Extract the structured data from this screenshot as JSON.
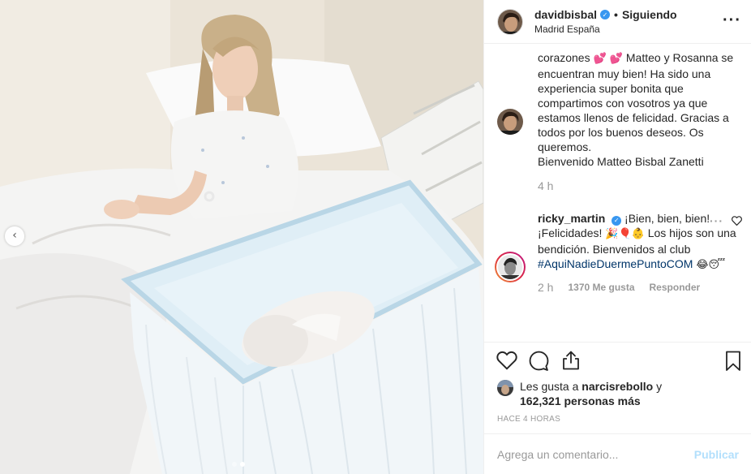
{
  "post": {
    "username": "davidbisbal",
    "verified": true,
    "separator": "•",
    "follow_status": "Siguiendo",
    "location": "Madrid España",
    "more_icon": "more-horizontal-icon"
  },
  "media": {
    "prev_icon": "chevron-left-icon",
    "prev_glyph": "‹",
    "slide_count": 2,
    "active_slide": 2
  },
  "caption": {
    "line_a": "corazones ",
    "emoji_a": "💕 💕",
    "line_b": " Matteo y Rosanna se encuentran muy bien! Ha sido una experiencia super bonita que compartimos con vosotros ya que estamos llenos de felicidad. Gracias a todos por los buenos deseos. Os queremos.",
    "line_c": "Bienvenido Matteo Bisbal Zanetti",
    "time": "4 h"
  },
  "comment": {
    "username": "ricky_martin",
    "verified": true,
    "text_a": " ¡Bien, bien, bien!¡Felicidades! ",
    "emoji_a": "🎉🎈👶",
    "text_b": " Los hijos son una bendición. Bienvenidos al club ",
    "hashtag": "#AquiNadieDuermePuntoCOM",
    "emoji_b": "😂😴",
    "time": "2 h",
    "likes": "1370 Me gusta",
    "reply": "Responder"
  },
  "likes": {
    "prefix": "Les gusta a ",
    "user": "narcisrebollo",
    "connector": " y",
    "count": "162,321 personas más"
  },
  "posted_ago": "HACE 4 HORAS",
  "composer": {
    "placeholder": "Agrega un comentario...",
    "publish": "Publicar"
  },
  "colors": {
    "link_blue": "#003569",
    "verified_blue": "#3897f0",
    "publish_disabled": "#b2dffc",
    "muted": "#999999"
  }
}
